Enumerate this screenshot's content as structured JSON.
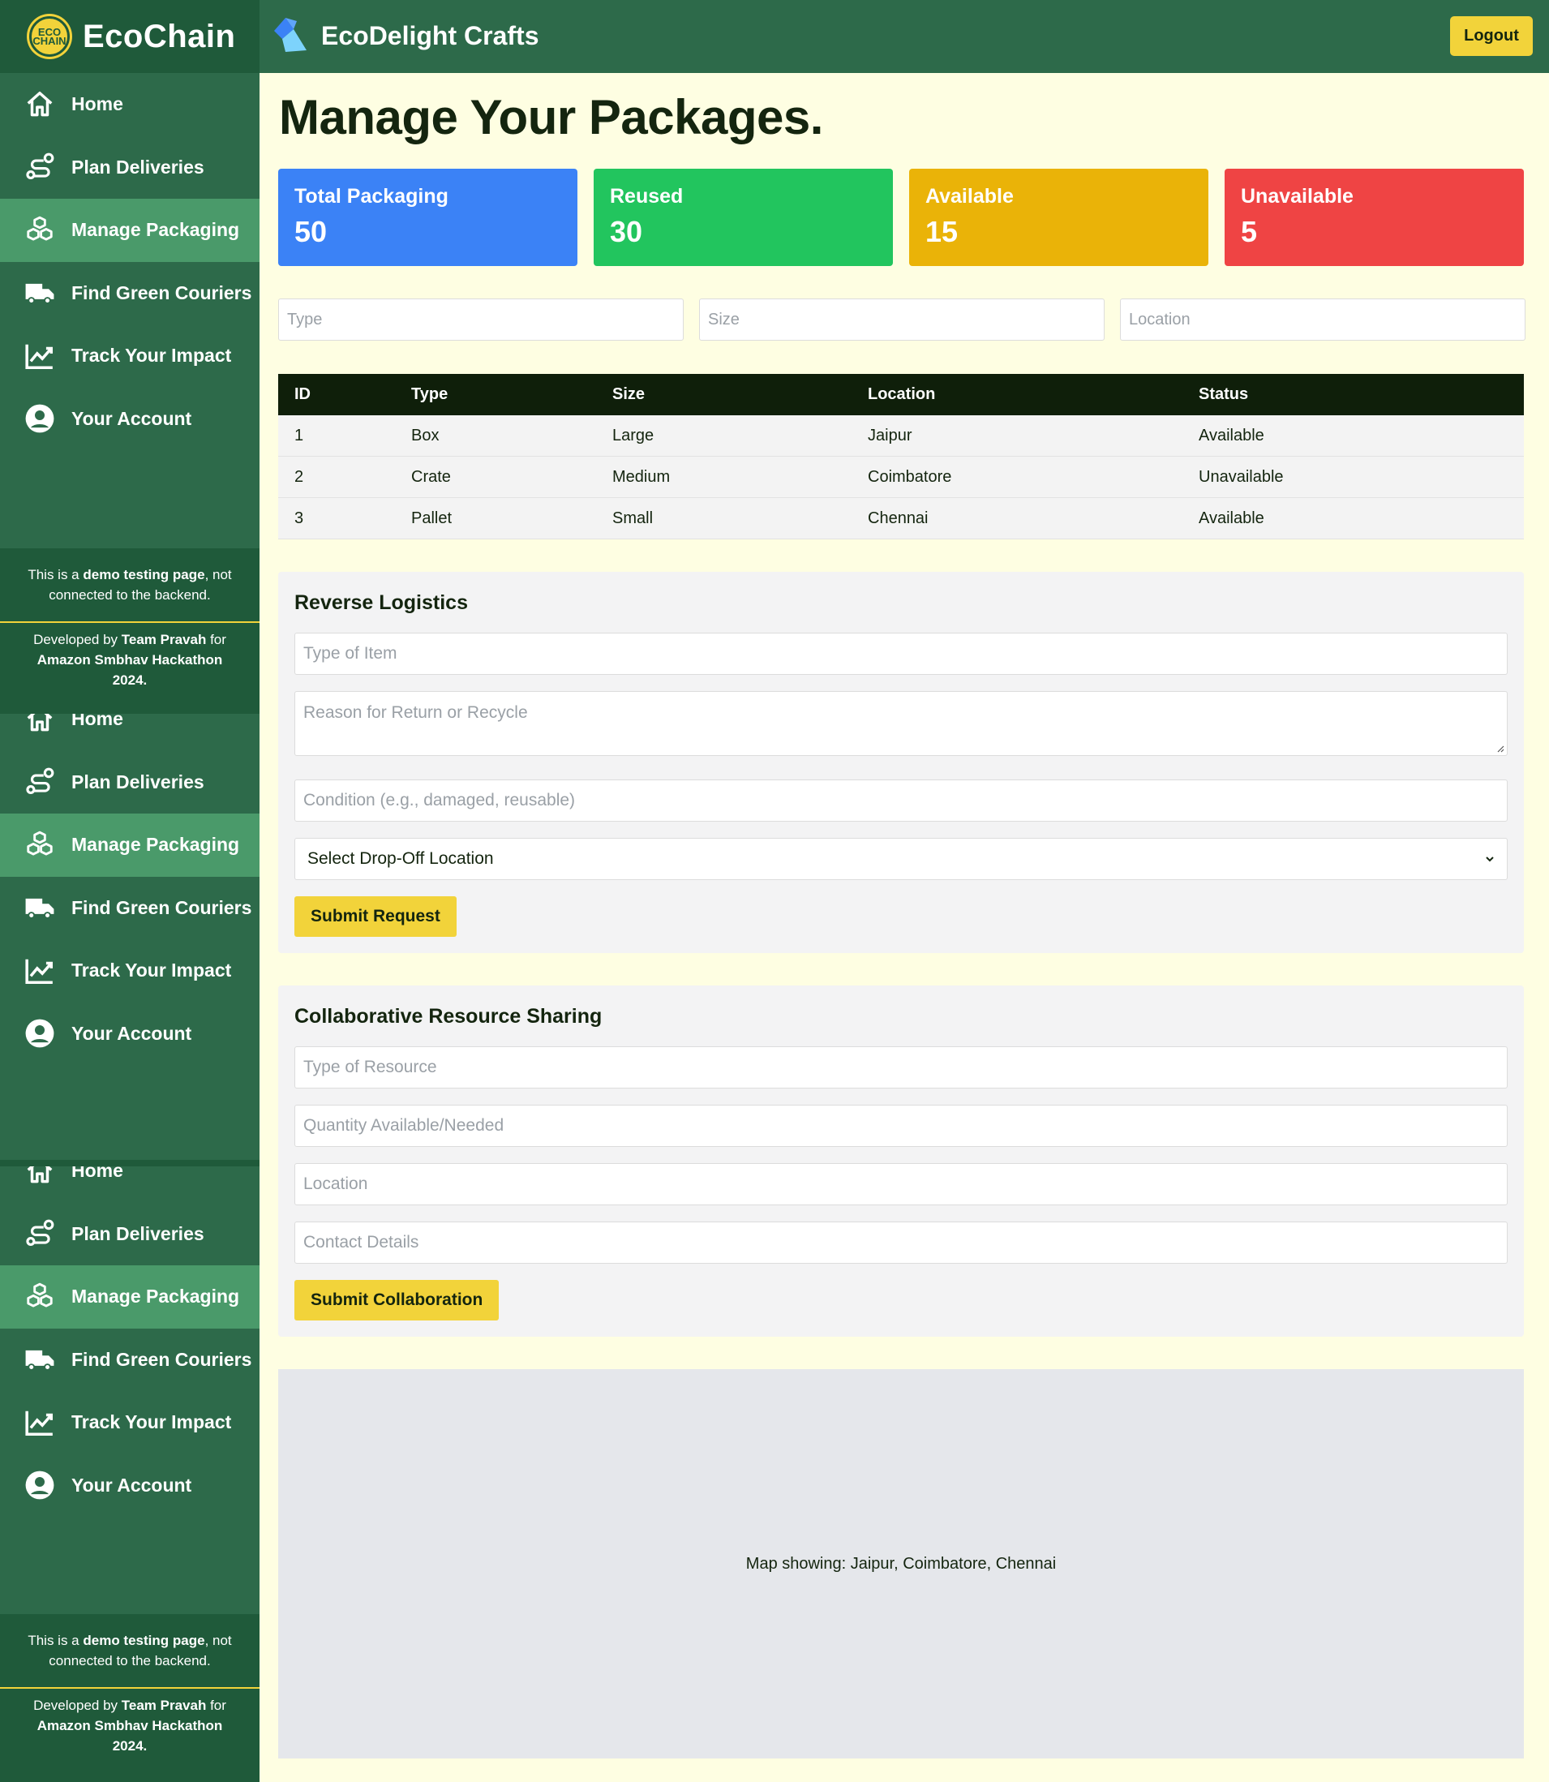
{
  "brand": {
    "name": "EcoChain",
    "logo_text": "ECO CHAIN"
  },
  "store": {
    "name": "EcoDelight Crafts"
  },
  "header": {
    "logout_label": "Logout"
  },
  "sidebar": {
    "items": [
      {
        "label": "Home",
        "icon": "home-icon"
      },
      {
        "label": "Plan Deliveries",
        "icon": "route-icon"
      },
      {
        "label": "Manage Packaging",
        "icon": "boxes-icon",
        "active": true
      },
      {
        "label": "Find Green Couriers",
        "icon": "truck-icon"
      },
      {
        "label": "Track Your Impact",
        "icon": "chart-line-icon"
      },
      {
        "label": "Your Account",
        "icon": "user-circle-icon"
      }
    ],
    "note_prefix": "This is a ",
    "note_bold": "demo testing page",
    "note_suffix": ", not connected to the backend.",
    "credit_prefix": "Developed by ",
    "credit_team": "Team Pravah",
    "credit_mid": " for ",
    "credit_event": "Amazon Smbhav Hackathon",
    "credit_year": "2024."
  },
  "page": {
    "title": "Manage Your Packages."
  },
  "stats": [
    {
      "label": "Total Packaging",
      "value": "50",
      "color": "#3b82f6"
    },
    {
      "label": "Reused",
      "value": "30",
      "color": "#22c55e"
    },
    {
      "label": "Available",
      "value": "15",
      "color": "#eab308"
    },
    {
      "label": "Unavailable",
      "value": "5",
      "color": "#ef4444"
    }
  ],
  "filters": {
    "type_placeholder": "Type",
    "size_placeholder": "Size",
    "location_placeholder": "Location"
  },
  "table": {
    "headers": [
      "ID",
      "Type",
      "Size",
      "Location",
      "Status"
    ],
    "rows": [
      [
        "1",
        "Box",
        "Large",
        "Jaipur",
        "Available"
      ],
      [
        "2",
        "Crate",
        "Medium",
        "Coimbatore",
        "Unavailable"
      ],
      [
        "3",
        "Pallet",
        "Small",
        "Chennai",
        "Available"
      ]
    ]
  },
  "reverse_logistics": {
    "title": "Reverse Logistics",
    "item_placeholder": "Type of Item",
    "reason_placeholder": "Reason for Return or Recycle",
    "condition_placeholder": "Condition (e.g., damaged, reusable)",
    "dropoff_selected": "Select Drop-Off Location",
    "submit_label": "Submit Request"
  },
  "collaboration": {
    "title": "Collaborative Resource Sharing",
    "resource_placeholder": "Type of Resource",
    "quantity_placeholder": "Quantity Available/Needed",
    "location_placeholder": "Location",
    "contact_placeholder": "Contact Details",
    "submit_label": "Submit Collaboration"
  },
  "map": {
    "caption": "Map showing: Jaipur, Coimbatore, Chennai"
  },
  "colors": {
    "primary_green": "#2d6a4a",
    "dark_green": "#1f5a3a",
    "active_green": "#4a9a6a",
    "accent_yellow": "#f2d33a",
    "page_bg": "#fefee2"
  }
}
